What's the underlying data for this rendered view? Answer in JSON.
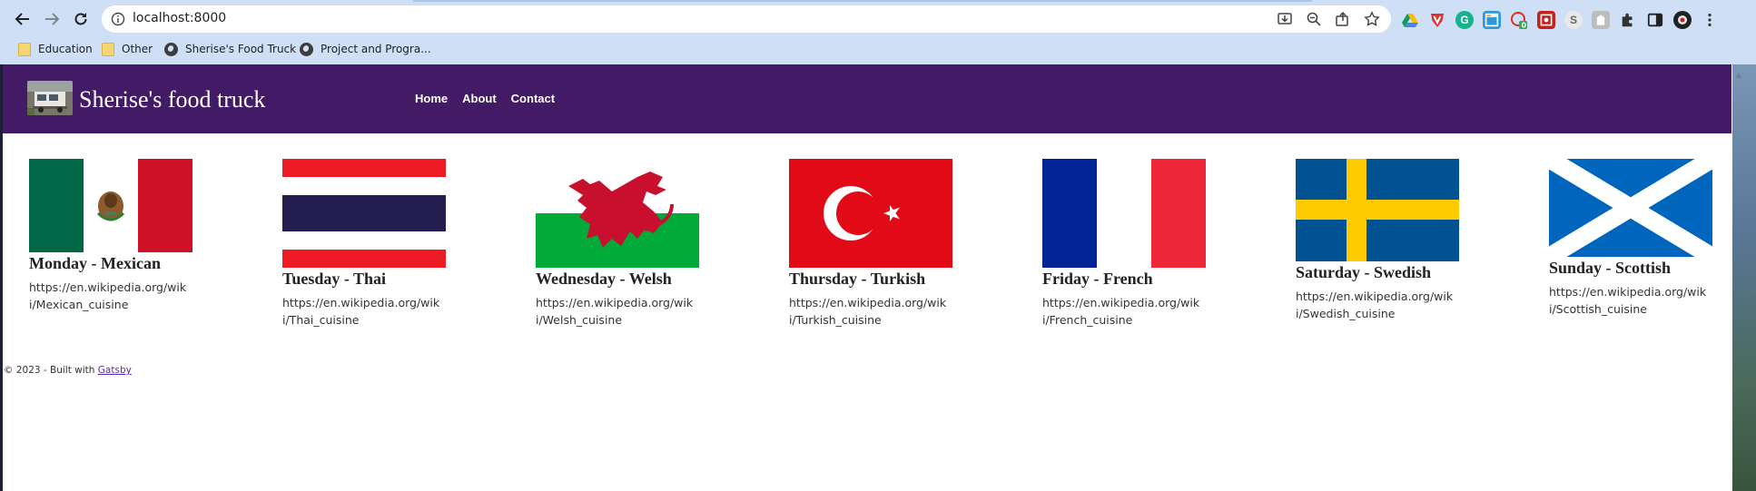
{
  "browser": {
    "url": "localhost:8000",
    "bookmarks": [
      {
        "label": "Education",
        "icon": "folder-icon"
      },
      {
        "label": "Other",
        "icon": "folder-icon"
      },
      {
        "label": "Sherise's Food Truck",
        "icon": "globe-icon"
      },
      {
        "label": "Project and Progra...",
        "icon": "globe-icon"
      }
    ]
  },
  "site": {
    "title": "Sherise's food truck",
    "nav": [
      "Home",
      "About",
      "Contact"
    ],
    "header_color": "#421a66"
  },
  "cards": [
    {
      "heading": "Monday - Mexican",
      "link": "https://en.wikipedia.org/wiki/Mexican_cuisine",
      "flag": "mexico-flag"
    },
    {
      "heading": "Tuesday - Thai",
      "link": "https://en.wikipedia.org/wiki/Thai_cuisine",
      "flag": "thailand-flag"
    },
    {
      "heading": "Wednesday - Welsh",
      "link": "https://en.wikipedia.org/wiki/Welsh_cuisine",
      "flag": "wales-flag"
    },
    {
      "heading": "Thursday - Turkish",
      "link": "https://en.wikipedia.org/wiki/Turkish_cuisine",
      "flag": "turkey-flag"
    },
    {
      "heading": "Friday - French",
      "link": "https://en.wikipedia.org/wiki/French_cuisine",
      "flag": "france-flag"
    },
    {
      "heading": "Saturday - Swedish",
      "link": "https://en.wikipedia.org/wiki/Swedish_cuisine",
      "flag": "sweden-flag"
    },
    {
      "heading": "Sunday - Scottish",
      "link": "https://en.wikipedia.org/wiki/Scottish_cuisine",
      "flag": "scotland-flag"
    }
  ],
  "footer": {
    "text": "© 2023 - Built with",
    "link": "Gatsby"
  }
}
